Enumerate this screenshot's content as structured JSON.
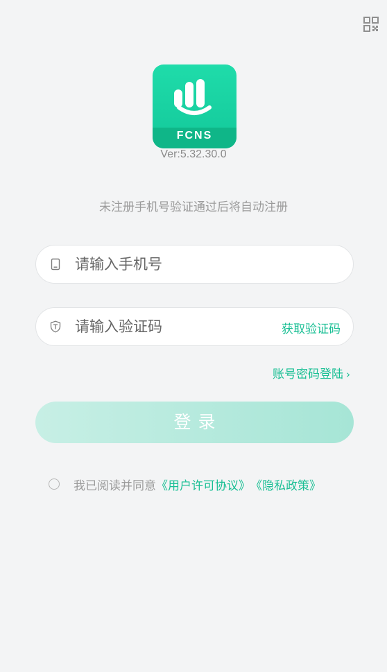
{
  "header": {
    "qr_icon": "qr-code-icon"
  },
  "app": {
    "logo_text": "FCNS",
    "version": "Ver:5.32.30.0",
    "brand_color": "#13c89a"
  },
  "hint": "未注册手机号验证通过后将自动注册",
  "phone": {
    "icon": "phone-icon",
    "placeholder": "请输入手机号",
    "value": ""
  },
  "code": {
    "icon": "shield-icon",
    "placeholder": "请输入验证码",
    "value": "",
    "get_code_label": "获取验证码"
  },
  "password_login": {
    "label": "账号密码登陆",
    "chevron": "›"
  },
  "login_button": {
    "label": "登录"
  },
  "agreement": {
    "checked": false,
    "text": "我已阅读并同意",
    "user_license": "《用户许可协议》",
    "privacy": "《隐私政策》"
  },
  "colors": {
    "accent": "#19bf94",
    "background": "#f3f4f5",
    "button_gradient_start": "#c7efe5",
    "button_gradient_end": "#a6e5d6"
  }
}
